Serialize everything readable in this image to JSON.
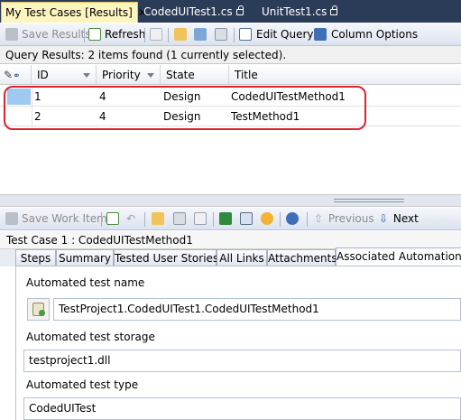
{
  "doc_tabs": [
    {
      "label": "My Test Cases [Results]",
      "active": true
    },
    {
      "label": "CodedUITest1.cs",
      "active": false
    },
    {
      "label": "UnitTest1.cs",
      "active": false
    }
  ],
  "query_toolbar": {
    "save_results": "Save Results",
    "refresh": "Refresh",
    "edit_query": "Edit Query",
    "column_options": "Column Options"
  },
  "query_status": "Query Results: 2 items found (1 currently selected).",
  "grid": {
    "columns": {
      "id": "ID",
      "priority": "Priority",
      "state": "State",
      "title": "Title"
    },
    "rows": [
      {
        "id": "1",
        "priority": "4",
        "state": "Design",
        "title": "CodedUITestMethod1",
        "selected": true
      },
      {
        "id": "2",
        "priority": "4",
        "state": "Design",
        "title": "TestMethod1",
        "selected": false
      }
    ]
  },
  "workitem_toolbar": {
    "save_work_item": "Save Work Item",
    "previous": "Previous",
    "next": "Next"
  },
  "work_item_title": "Test Case 1 : CodedUITestMethod1",
  "work_item_tabs": [
    "Steps",
    "Summary",
    "Tested User Stories",
    "All Links",
    "Attachments",
    "Associated Automation"
  ],
  "automation": {
    "name_label": "Automated test name",
    "name_value": "TestProject1.CodedUITest1.CodedUITestMethod1",
    "storage_label": "Automated test storage",
    "storage_value": "testproject1.dll",
    "type_label": "Automated test type",
    "type_value": "CodedUITest"
  },
  "colors": {
    "tabstrip_bg": "#2b3c59",
    "active_tab_bg": "#fdf4bf",
    "selection_marker": "#9ec9f0",
    "highlight_ring": "#d9232d"
  }
}
